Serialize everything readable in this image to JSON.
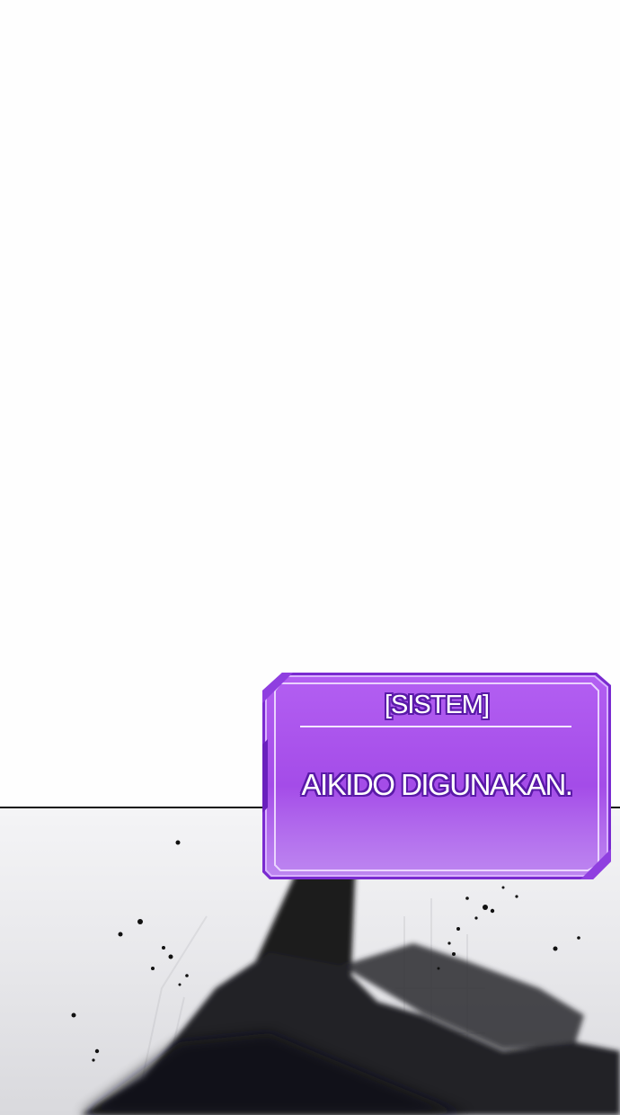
{
  "system_window": {
    "title": "[SISTEM]",
    "message": "AIKIDO DIGUNAKAN."
  },
  "colors": {
    "window_fill": "#b96cf5",
    "window_border": "#7a2bd0",
    "text_outline": "#5a1aa8",
    "divider": "#111111"
  }
}
